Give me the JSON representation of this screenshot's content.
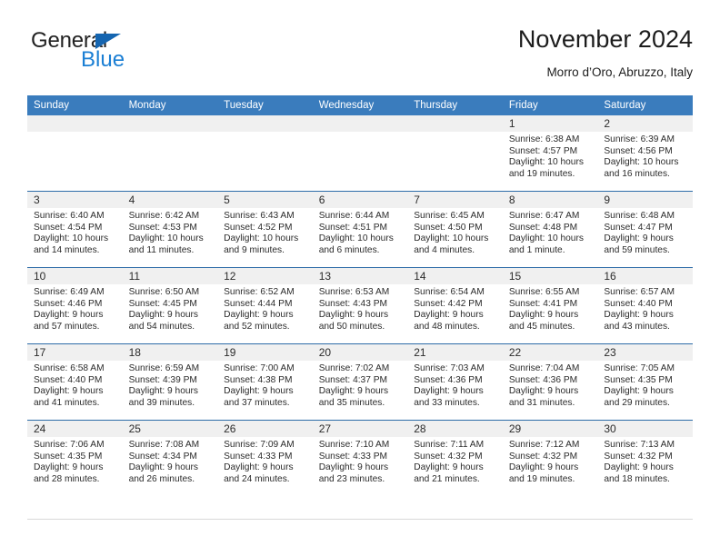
{
  "brand": {
    "word1": "General",
    "word2": "Blue",
    "triangle_color": "#1565b0",
    "blue_color": "#1b7fd4"
  },
  "header": {
    "title": "November 2024",
    "subtitle": "Morro d’Oro, Abruzzo, Italy"
  },
  "theme": {
    "header_bg": "#3a7cbd",
    "row_rule": "#2d6ca8",
    "numband_bg": "#f0f0f0",
    "text": "#2b2b2b"
  },
  "weekdays": [
    "Sunday",
    "Monday",
    "Tuesday",
    "Wednesday",
    "Thursday",
    "Friday",
    "Saturday"
  ],
  "labels": {
    "sunrise_prefix": "Sunrise: ",
    "sunset_prefix": "Sunset: ",
    "daylight_prefix": "Daylight: "
  },
  "weeks": [
    [
      {
        "day": "",
        "empty": true
      },
      {
        "day": "",
        "empty": true
      },
      {
        "day": "",
        "empty": true
      },
      {
        "day": "",
        "empty": true
      },
      {
        "day": "",
        "empty": true
      },
      {
        "day": "1",
        "sunrise": "Sunrise: 6:38 AM",
        "sunset": "Sunset: 4:57 PM",
        "daylight": "Daylight: 10 hours and 19 minutes."
      },
      {
        "day": "2",
        "sunrise": "Sunrise: 6:39 AM",
        "sunset": "Sunset: 4:56 PM",
        "daylight": "Daylight: 10 hours and 16 minutes."
      }
    ],
    [
      {
        "day": "3",
        "sunrise": "Sunrise: 6:40 AM",
        "sunset": "Sunset: 4:54 PM",
        "daylight": "Daylight: 10 hours and 14 minutes."
      },
      {
        "day": "4",
        "sunrise": "Sunrise: 6:42 AM",
        "sunset": "Sunset: 4:53 PM",
        "daylight": "Daylight: 10 hours and 11 minutes."
      },
      {
        "day": "5",
        "sunrise": "Sunrise: 6:43 AM",
        "sunset": "Sunset: 4:52 PM",
        "daylight": "Daylight: 10 hours and 9 minutes."
      },
      {
        "day": "6",
        "sunrise": "Sunrise: 6:44 AM",
        "sunset": "Sunset: 4:51 PM",
        "daylight": "Daylight: 10 hours and 6 minutes."
      },
      {
        "day": "7",
        "sunrise": "Sunrise: 6:45 AM",
        "sunset": "Sunset: 4:50 PM",
        "daylight": "Daylight: 10 hours and 4 minutes."
      },
      {
        "day": "8",
        "sunrise": "Sunrise: 6:47 AM",
        "sunset": "Sunset: 4:48 PM",
        "daylight": "Daylight: 10 hours and 1 minute."
      },
      {
        "day": "9",
        "sunrise": "Sunrise: 6:48 AM",
        "sunset": "Sunset: 4:47 PM",
        "daylight": "Daylight: 9 hours and 59 minutes."
      }
    ],
    [
      {
        "day": "10",
        "sunrise": "Sunrise: 6:49 AM",
        "sunset": "Sunset: 4:46 PM",
        "daylight": "Daylight: 9 hours and 57 minutes."
      },
      {
        "day": "11",
        "sunrise": "Sunrise: 6:50 AM",
        "sunset": "Sunset: 4:45 PM",
        "daylight": "Daylight: 9 hours and 54 minutes."
      },
      {
        "day": "12",
        "sunrise": "Sunrise: 6:52 AM",
        "sunset": "Sunset: 4:44 PM",
        "daylight": "Daylight: 9 hours and 52 minutes."
      },
      {
        "day": "13",
        "sunrise": "Sunrise: 6:53 AM",
        "sunset": "Sunset: 4:43 PM",
        "daylight": "Daylight: 9 hours and 50 minutes."
      },
      {
        "day": "14",
        "sunrise": "Sunrise: 6:54 AM",
        "sunset": "Sunset: 4:42 PM",
        "daylight": "Daylight: 9 hours and 48 minutes."
      },
      {
        "day": "15",
        "sunrise": "Sunrise: 6:55 AM",
        "sunset": "Sunset: 4:41 PM",
        "daylight": "Daylight: 9 hours and 45 minutes."
      },
      {
        "day": "16",
        "sunrise": "Sunrise: 6:57 AM",
        "sunset": "Sunset: 4:40 PM",
        "daylight": "Daylight: 9 hours and 43 minutes."
      }
    ],
    [
      {
        "day": "17",
        "sunrise": "Sunrise: 6:58 AM",
        "sunset": "Sunset: 4:40 PM",
        "daylight": "Daylight: 9 hours and 41 minutes."
      },
      {
        "day": "18",
        "sunrise": "Sunrise: 6:59 AM",
        "sunset": "Sunset: 4:39 PM",
        "daylight": "Daylight: 9 hours and 39 minutes."
      },
      {
        "day": "19",
        "sunrise": "Sunrise: 7:00 AM",
        "sunset": "Sunset: 4:38 PM",
        "daylight": "Daylight: 9 hours and 37 minutes."
      },
      {
        "day": "20",
        "sunrise": "Sunrise: 7:02 AM",
        "sunset": "Sunset: 4:37 PM",
        "daylight": "Daylight: 9 hours and 35 minutes."
      },
      {
        "day": "21",
        "sunrise": "Sunrise: 7:03 AM",
        "sunset": "Sunset: 4:36 PM",
        "daylight": "Daylight: 9 hours and 33 minutes."
      },
      {
        "day": "22",
        "sunrise": "Sunrise: 7:04 AM",
        "sunset": "Sunset: 4:36 PM",
        "daylight": "Daylight: 9 hours and 31 minutes."
      },
      {
        "day": "23",
        "sunrise": "Sunrise: 7:05 AM",
        "sunset": "Sunset: 4:35 PM",
        "daylight": "Daylight: 9 hours and 29 minutes."
      }
    ],
    [
      {
        "day": "24",
        "sunrise": "Sunrise: 7:06 AM",
        "sunset": "Sunset: 4:35 PM",
        "daylight": "Daylight: 9 hours and 28 minutes."
      },
      {
        "day": "25",
        "sunrise": "Sunrise: 7:08 AM",
        "sunset": "Sunset: 4:34 PM",
        "daylight": "Daylight: 9 hours and 26 minutes."
      },
      {
        "day": "26",
        "sunrise": "Sunrise: 7:09 AM",
        "sunset": "Sunset: 4:33 PM",
        "daylight": "Daylight: 9 hours and 24 minutes."
      },
      {
        "day": "27",
        "sunrise": "Sunrise: 7:10 AM",
        "sunset": "Sunset: 4:33 PM",
        "daylight": "Daylight: 9 hours and 23 minutes."
      },
      {
        "day": "28",
        "sunrise": "Sunrise: 7:11 AM",
        "sunset": "Sunset: 4:32 PM",
        "daylight": "Daylight: 9 hours and 21 minutes."
      },
      {
        "day": "29",
        "sunrise": "Sunrise: 7:12 AM",
        "sunset": "Sunset: 4:32 PM",
        "daylight": "Daylight: 9 hours and 19 minutes."
      },
      {
        "day": "30",
        "sunrise": "Sunrise: 7:13 AM",
        "sunset": "Sunset: 4:32 PM",
        "daylight": "Daylight: 9 hours and 18 minutes."
      }
    ]
  ]
}
